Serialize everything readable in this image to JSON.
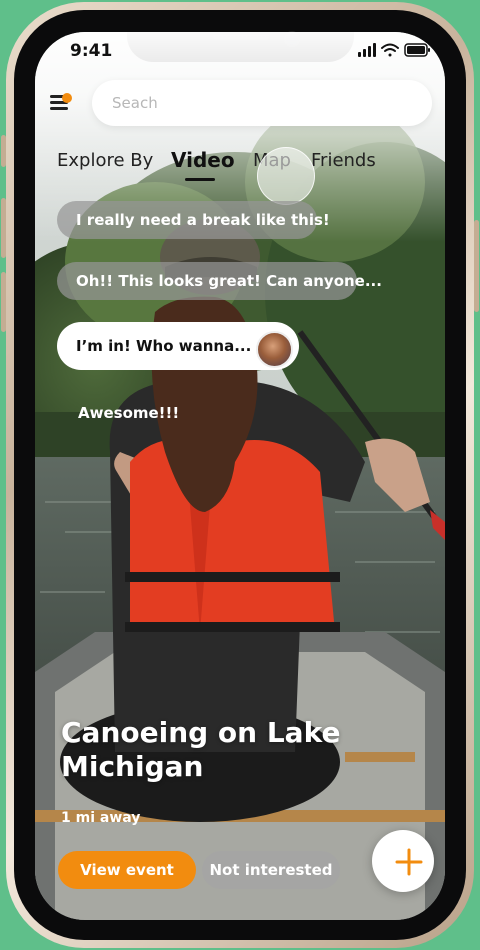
{
  "status": {
    "time": "9:41"
  },
  "search": {
    "placeholder": "Seach"
  },
  "tabs": [
    {
      "label": "Explore By",
      "active": false
    },
    {
      "label": "Video",
      "active": true
    },
    {
      "label": "Map",
      "active": false
    },
    {
      "label": "Friends",
      "active": false
    }
  ],
  "comments": [
    {
      "text": "I really need a break like this!"
    },
    {
      "text": "Oh!! This looks great! Can anyone..."
    },
    {
      "text": "I’m in! Who wanna..."
    },
    {
      "text": "Awesome!!!"
    }
  ],
  "event": {
    "title": "Canoeing on Lake Michigan",
    "distance": "1 mi away"
  },
  "actions": {
    "view_label": "View event",
    "not_interested_label": "Not interested"
  },
  "colors": {
    "accent": "#f28c0f",
    "background": "#5fbf8a"
  },
  "icons": {
    "menu": "menu-icon",
    "add": "plus-icon",
    "signal": "cellular-signal-icon",
    "wifi": "wifi-icon",
    "battery": "battery-icon"
  }
}
